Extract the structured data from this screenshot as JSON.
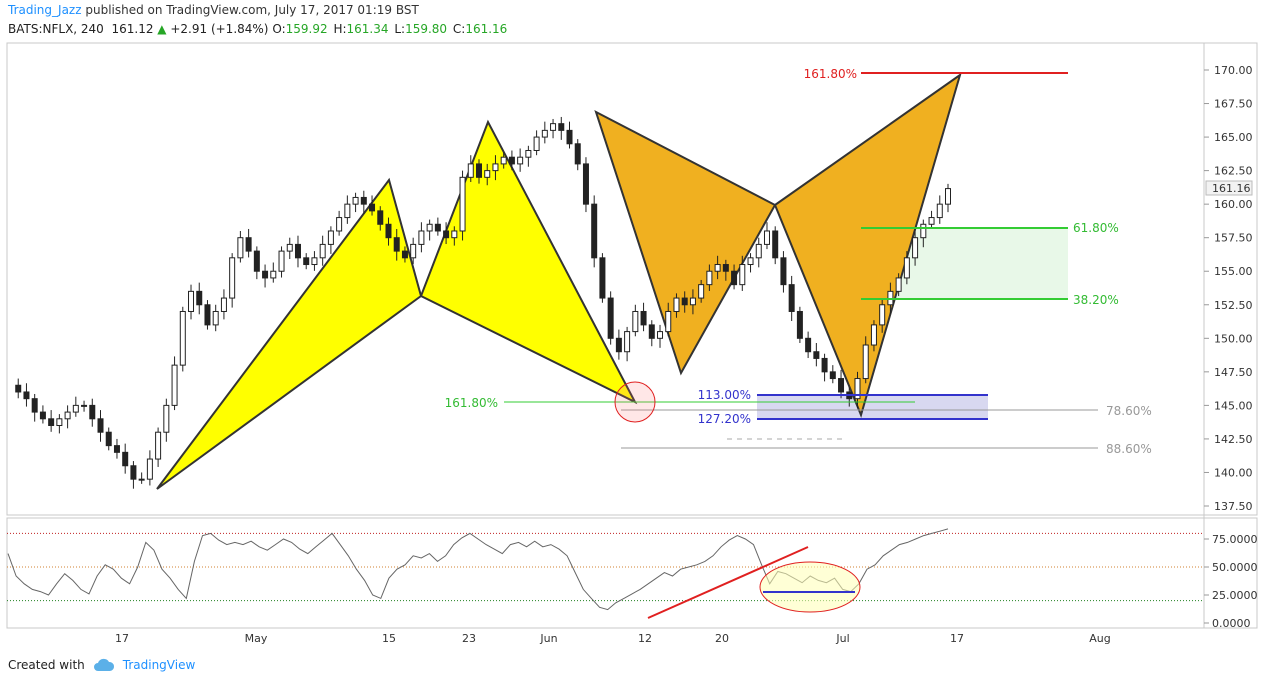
{
  "header": {
    "author": "Trading_Jazz",
    "published_text": "published on TradingView.com, July 17, 2017 01:19 BST"
  },
  "symbol_bar": {
    "symbol": "BATS:NFLX, 240",
    "last": "161.12",
    "change_arrow": "▲",
    "change": "+2.91 (+1.84%)",
    "o_label": "O:",
    "o": "159.92",
    "h_label": "H:",
    "h": "161.34",
    "l_label": "L:",
    "l": "159.80",
    "c_label": "C:",
    "c": "161.16"
  },
  "footer": {
    "created_with": "Created with",
    "brand": "TradingView",
    "logo_icon": "cloud-icon"
  },
  "colors": {
    "pattern_fill_1": "#ffff00",
    "pattern_fill_2": "#f0b020",
    "fib_red": "#e02020",
    "fib_green": "#33cc33",
    "fib_blue": "#3333cc",
    "fib_gray": "#999999",
    "candle_up": "#ffffff",
    "candle_down": "#222222",
    "rsi_trendline": "#e02020"
  },
  "chart_data": [
    {
      "type": "candlestick",
      "symbol": "BATS:NFLX",
      "interval": "240",
      "ylim": [
        136.5,
        171.5
      ],
      "y_ticks": [
        "137.50",
        "140.00",
        "142.50",
        "145.00",
        "147.50",
        "150.00",
        "152.50",
        "155.00",
        "157.50",
        "160.00",
        "162.50",
        "165.00",
        "167.50",
        "170.00"
      ],
      "last_price_label": "161.16",
      "x_tick_labels": [
        "17",
        "May",
        "15",
        "23",
        "Jun",
        "12",
        "20",
        "Jul",
        "17",
        "Aug"
      ],
      "price_path": [
        146.5,
        146,
        145.5,
        144.5,
        144,
        143.5,
        144,
        144.5,
        145,
        145,
        144,
        143,
        142,
        141.5,
        140.5,
        139.5,
        139.5,
        141,
        143,
        145,
        148,
        152,
        153.5,
        152.5,
        151,
        152,
        153,
        156,
        157.5,
        156.5,
        155,
        154.5,
        155,
        156.5,
        157,
        156,
        155.5,
        156,
        157,
        158,
        159,
        160,
        160.5,
        160,
        159.5,
        158.5,
        157.5,
        156.5,
        156,
        157,
        158,
        158.5,
        158,
        157.5,
        158,
        162,
        163,
        162,
        162.5,
        163,
        163.5,
        163,
        163.5,
        164,
        165,
        165.5,
        166,
        165.5,
        164.5,
        163,
        160,
        156,
        153,
        150,
        149,
        150.5,
        152,
        151,
        150,
        150.5,
        152,
        153,
        152.5,
        153,
        154,
        155,
        155.5,
        155,
        154,
        155.5,
        156,
        157,
        158,
        156,
        154,
        152,
        150,
        149,
        148.5,
        147.5,
        147,
        146,
        145.5,
        147,
        149.5,
        151,
        152.5,
        153.5,
        154.5,
        156,
        157.5,
        158.5,
        159,
        160,
        161.16
      ],
      "fib_levels_upper": {
        "161.80%": 169.6,
        "61.80%": 158.3,
        "38.20%": 152.9
      },
      "fib_levels_lower": {
        "161.80%": 145.3,
        "113.00%": 145.8,
        "127.20%": 143.9,
        "78.60%": 144.5,
        "88.60%": 141.7
      }
    },
    {
      "type": "line",
      "name": "",
      "ylim": [
        0,
        85
      ],
      "y_ticks": [
        "0.0000",
        "25.0000",
        "50.0000",
        "75.0000"
      ],
      "levels": [
        80,
        50,
        20
      ],
      "values": [
        62,
        42,
        35,
        30,
        28,
        25,
        35,
        44,
        38,
        30,
        26,
        42,
        52,
        48,
        40,
        35,
        50,
        72,
        65,
        48,
        40,
        30,
        22,
        55,
        78,
        80,
        74,
        70,
        72,
        70,
        73,
        68,
        65,
        70,
        75,
        72,
        66,
        62,
        68,
        74,
        80,
        70,
        60,
        48,
        38,
        25,
        22,
        40,
        48,
        52,
        60,
        58,
        62,
        55,
        60,
        70,
        76,
        80,
        75,
        70,
        66,
        62,
        70,
        72,
        68,
        73,
        68,
        70,
        66,
        60,
        45,
        30,
        22,
        14,
        12,
        18,
        22,
        26,
        30,
        35,
        40,
        45,
        42,
        48,
        50,
        52,
        55,
        60,
        68,
        74,
        78,
        75,
        70,
        52,
        35,
        46,
        44,
        40,
        36,
        42,
        38,
        36,
        40,
        30,
        28,
        35,
        48,
        52,
        60,
        65,
        70,
        72,
        75,
        78,
        80,
        82,
        84
      ]
    }
  ],
  "annotations": {
    "fib_161_top": "161.80%",
    "fib_618": "61.80%",
    "fib_382": "38.20%",
    "fib_161_left": "161.80%",
    "fib_113": "113.00%",
    "fib_127": "127.20%",
    "fib_786": "78.60%",
    "fib_886": "88.60%"
  }
}
